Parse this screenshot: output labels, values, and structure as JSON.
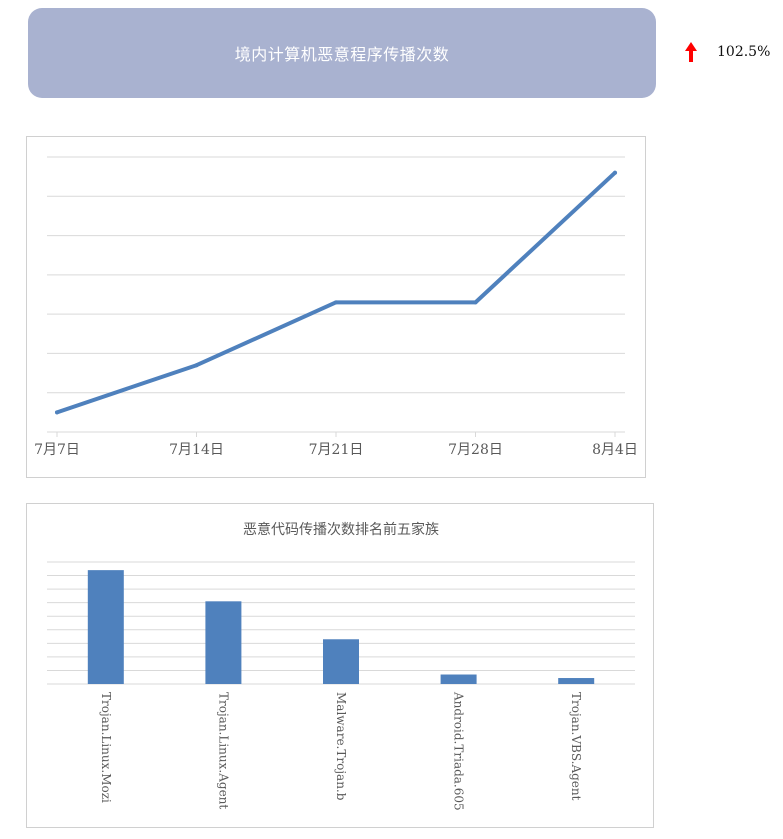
{
  "header": {
    "title": "境内计算机恶意程序传播次数",
    "change_value": "102.5%",
    "change_direction_icon": "arrow-up-icon",
    "change_color": "#ff0000",
    "banner_color": "#a9b2d0"
  },
  "chart_data": [
    {
      "type": "line",
      "title": "",
      "categories": [
        "7月7日",
        "7月14日",
        "7月21日",
        "7月28日",
        "8月4日"
      ],
      "series": [
        {
          "values": [
            0.5,
            1.7,
            3.3,
            3.3,
            6.6
          ]
        }
      ],
      "ylim": [
        0,
        7
      ],
      "grid": true,
      "color": "#4f81bd"
    },
    {
      "type": "bar",
      "title": "恶意代码传播次数排名前五家族",
      "categories": [
        "Trojan.Linux.Mozi",
        "Trojan.Linux.Agent",
        "Malware.Trojan.b",
        "Android.Triada.605",
        "Trojan.VBS.Agent"
      ],
      "values": [
        4.2,
        3.05,
        1.65,
        0.35,
        0.22
      ],
      "ylim": [
        0,
        4.5
      ],
      "grid": true,
      "color": "#4f81bd"
    }
  ]
}
